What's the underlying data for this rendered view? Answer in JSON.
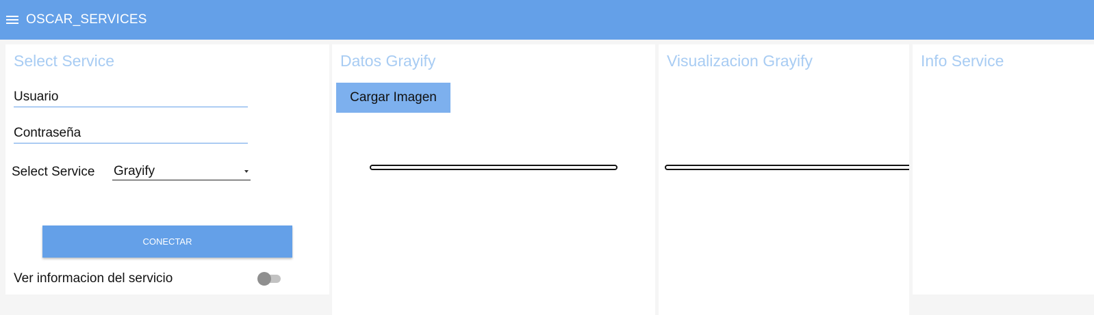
{
  "header": {
    "title": "OSCAR_SERVICES",
    "menu_icon": "hamburger-menu-icon",
    "background_color": "#64a0e8"
  },
  "select_service_panel": {
    "title": "Select Service",
    "username_placeholder": "Usuario",
    "password_placeholder": "Contraseña",
    "select_label": "Select Service",
    "selected_service": "Grayify",
    "connect_label": "CONECTAR",
    "toggle_label": "Ver informacion del servicio",
    "toggle_on": false
  },
  "datos_panel": {
    "title": "Datos Grayify",
    "load_button_label": "Cargar Imagen"
  },
  "visualizacion_panel": {
    "title": "Visualizacion Grayify"
  },
  "info_panel": {
    "title": "Info Service"
  },
  "colors": {
    "accent": "#64a0e8",
    "panel_title": "#a8ccf3",
    "load_button": "#7db0ee"
  }
}
